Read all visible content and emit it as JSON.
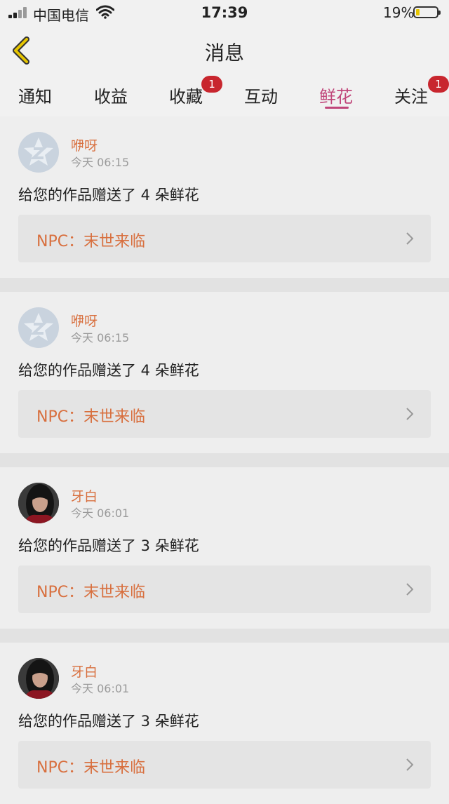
{
  "status_bar": {
    "carrier": "中国电信",
    "time": "17:39",
    "battery_pct": "19%",
    "battery_level": 0.19
  },
  "nav": {
    "title": "消息"
  },
  "tabs": [
    {
      "label": "通知",
      "badge": ""
    },
    {
      "label": "收益",
      "badge": ""
    },
    {
      "label": "收藏",
      "badge": "1"
    },
    {
      "label": "互动",
      "badge": ""
    },
    {
      "label": "鲜花",
      "badge": "",
      "active": true
    },
    {
      "label": "关注",
      "badge": "1"
    }
  ],
  "notifications": [
    {
      "name": "咿呀",
      "time": "今天 06:15",
      "message": "给您的作品赠送了 4 朵鲜花",
      "work": "NPC：末世来临",
      "avatar": "default"
    },
    {
      "name": "咿呀",
      "time": "今天 06:15",
      "message": "给您的作品赠送了 4 朵鲜花",
      "work": "NPC：末世来临",
      "avatar": "default"
    },
    {
      "name": "牙白",
      "time": "今天 06:01",
      "message": "给您的作品赠送了 3 朵鲜花",
      "work": "NPC：末世来临",
      "avatar": "photo"
    },
    {
      "name": "牙白",
      "time": "今天 06:01",
      "message": "给您的作品赠送了 3 朵鲜花",
      "work": "NPC：末世来临",
      "avatar": "photo"
    }
  ],
  "colors": {
    "accent_pink": "#c0467a",
    "name_orange": "#d86f3e",
    "badge_red": "#c8262e",
    "back_arrow": "#e6c500"
  }
}
